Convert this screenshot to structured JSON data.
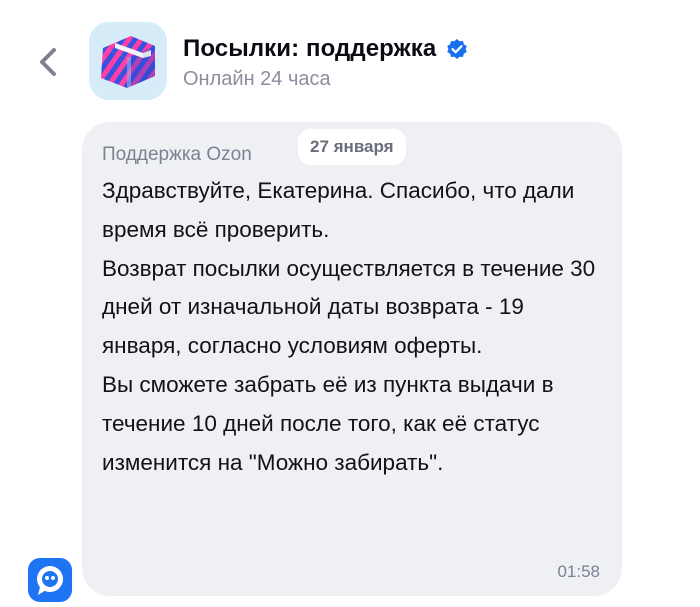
{
  "header": {
    "title": "Посылки: поддержка",
    "subtitle": "Онлайн 24 часа",
    "avatar_icon": "gift-box-icon",
    "verified_icon": "verified-check-icon",
    "back_icon": "chevron-left-icon",
    "accent_color": "#1a6ff0"
  },
  "message": {
    "sender": "Поддержка Ozon",
    "date": "27 января",
    "paragraphs": [
      "Здравствуйте, Екатерина. Спасибо, что дали время всё проверить.",
      "Возврат посылки осуществляется в течение 30 дней от изначальной даты возврата - 19 января, согласно условиям оферты.",
      "Вы сможете забрать её из пункта выдачи в течение 10 дней после того, как её статус изменится на \"Можно забирать\"."
    ],
    "time": "01:58"
  },
  "bot_icon": "support-bot-icon"
}
